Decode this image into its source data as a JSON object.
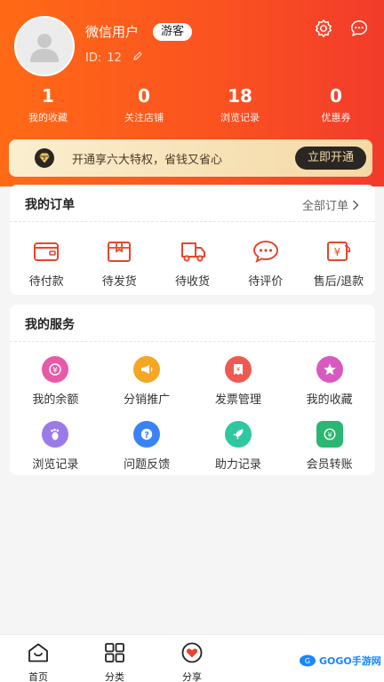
{
  "profile": {
    "username": "微信用户",
    "guest_badge": "游客",
    "id_label": "ID:",
    "id_value": "12"
  },
  "stats": [
    {
      "value": "1",
      "label": "我的收藏"
    },
    {
      "value": "0",
      "label": "关注店铺"
    },
    {
      "value": "18",
      "label": "浏览记录"
    },
    {
      "value": "0",
      "label": "优惠券"
    }
  ],
  "vip": {
    "text": "开通享六大特权，省钱又省心",
    "button": "立即开通"
  },
  "orders": {
    "title": "我的订单",
    "all_link": "全部订单",
    "items": [
      {
        "label": "待付款",
        "icon": "wallet-icon"
      },
      {
        "label": "待发货",
        "icon": "package-icon"
      },
      {
        "label": "待收货",
        "icon": "truck-icon"
      },
      {
        "label": "待评价",
        "icon": "comment-icon"
      },
      {
        "label": "售后/退款",
        "icon": "refund-icon"
      }
    ]
  },
  "services": {
    "title": "我的服务",
    "items": [
      {
        "label": "我的余额",
        "icon": "balance-icon",
        "color": "#e85aa8"
      },
      {
        "label": "分销推广",
        "icon": "megaphone-icon",
        "color": "#f5a623"
      },
      {
        "label": "发票管理",
        "icon": "invoice-icon",
        "color": "#ee5a52"
      },
      {
        "label": "我的收藏",
        "icon": "star-icon",
        "color": "#d85ac0"
      },
      {
        "label": "浏览记录",
        "icon": "footprint-icon",
        "color": "#9b7be8"
      },
      {
        "label": "问题反馈",
        "icon": "question-icon",
        "color": "#3b82f6"
      },
      {
        "label": "助力记录",
        "icon": "rocket-icon",
        "color": "#2fc7a0"
      },
      {
        "label": "会员转账",
        "icon": "transfer-icon",
        "color": "#2bb673"
      }
    ]
  },
  "tabbar": [
    {
      "label": "首页",
      "icon": "home-icon"
    },
    {
      "label": "分类",
      "icon": "category-icon"
    },
    {
      "label": "分享",
      "icon": "share-heart-icon"
    }
  ],
  "watermark": {
    "text": "GOGO手游网"
  },
  "colors": {
    "header_start": "#ff6a16",
    "header_end": "#f23b2b",
    "vip_gold": "#f4d9a5",
    "icon_red": "#e8452c"
  }
}
